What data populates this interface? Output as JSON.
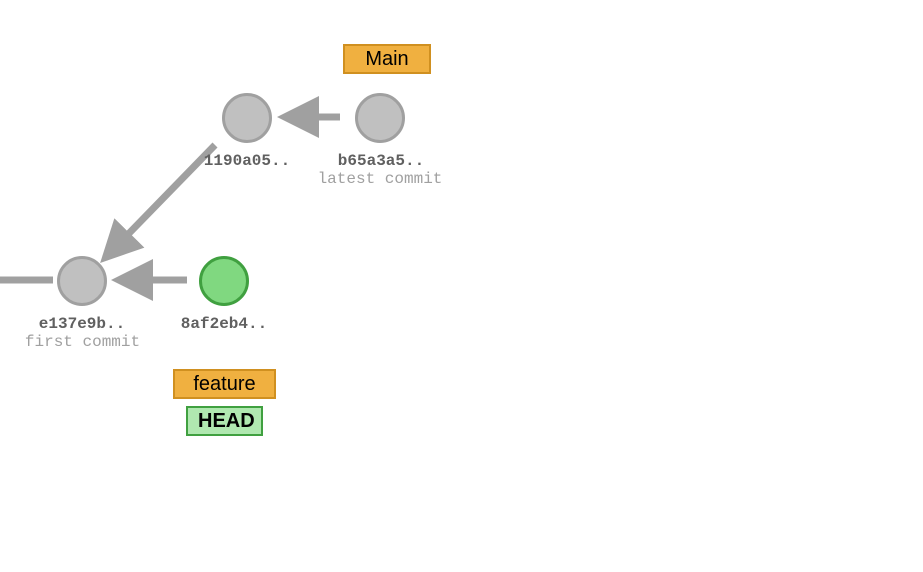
{
  "commits": {
    "e137e9b": {
      "hash": "e137e9b..",
      "msg": "first commit"
    },
    "c1190a05": {
      "hash": "1190a05..",
      "msg": ""
    },
    "b65a3a5": {
      "hash": "b65a3a5..",
      "msg": "latest commit"
    },
    "c8af2eb4": {
      "hash": "8af2eb4..",
      "msg": ""
    }
  },
  "branches": {
    "main": "Main",
    "feature": "feature"
  },
  "head": "HEAD"
}
